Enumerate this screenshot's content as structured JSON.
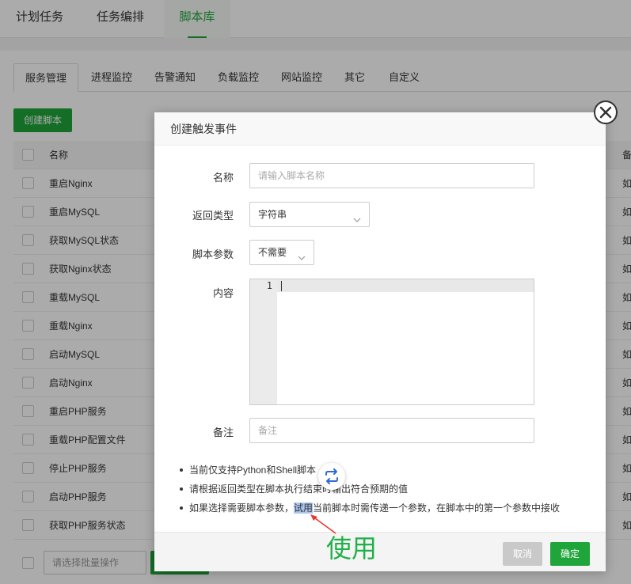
{
  "top_tabs": [
    "计划任务",
    "任务编排",
    "脚本库"
  ],
  "sub_tabs": [
    "服务管理",
    "进程监控",
    "告警通知",
    "负载监控",
    "网站监控",
    "其它",
    "自定义"
  ],
  "create_button": "创建脚本",
  "table": {
    "header_name": "名称",
    "header_right": "备",
    "rows": [
      "重启Nginx",
      "重启MySQL",
      "获取MySQL状态",
      "获取Nginx状态",
      "重载MySQL",
      "重载Nginx",
      "启动MySQL",
      "启动Nginx",
      "重启PHP服务",
      "重载PHP配置文件",
      "停止PHP服务",
      "启动PHP服务",
      "获取PHP服务状态"
    ],
    "row_right": "如"
  },
  "batch_select_placeholder": "请选择批量操作",
  "modal": {
    "title": "创建触发事件",
    "name_label": "名称",
    "name_placeholder": "请输入脚本名称",
    "return_type_label": "返回类型",
    "return_type_value": "字符串",
    "script_param_label": "脚本参数",
    "script_param_value": "不需要",
    "content_label": "内容",
    "editor_line_number": "1",
    "remark_label": "备注",
    "remark_placeholder": "备注",
    "tips": {
      "tip1": "当前仅支持Python和Shell脚本",
      "tip2": "请根据返回类型在脚本执行结束时输出符合预期的值",
      "tip3_before": "如果选择需要脚本参数，",
      "tip3_highlight": "试用",
      "tip3_after": "当前脚本时需传递一个参数，在脚本中的第一个参数中接收"
    },
    "cancel_button": "取消",
    "confirm_button": "确定"
  },
  "annotation": "使用",
  "colors": {
    "accent_green": "#20a53a",
    "annotation_green": "#20b04a",
    "annotation_arrow": "#e53935",
    "highlight": "#aac6ee"
  }
}
